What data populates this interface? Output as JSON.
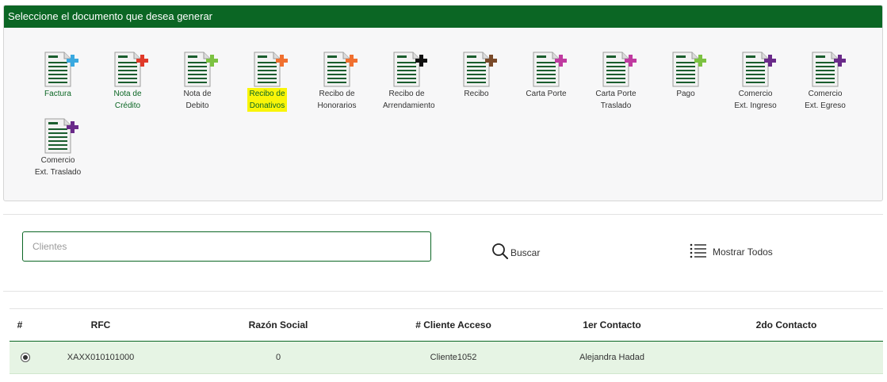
{
  "panel": {
    "title": "Seleccione el documento que desea generar",
    "header_color": "#0b6624",
    "documents": [
      {
        "label": "Factura",
        "icon": "document-plus-icon",
        "plus_color": "#3aa9e0",
        "label_style": "green"
      },
      {
        "label": "Nota de Crédito",
        "icon": "document-plus-icon",
        "plus_color": "#e03a2a",
        "label_style": "green"
      },
      {
        "label": "Nota de Debito",
        "icon": "document-plus-icon",
        "plus_color": "#7cc242",
        "label_style": "normal"
      },
      {
        "label": "Recibo de Donativos",
        "icon": "document-plus-icon",
        "plus_color": "#f07030",
        "label_style": "highlight"
      },
      {
        "label": "Recibo de Honorarios",
        "icon": "document-plus-icon",
        "plus_color": "#f07030",
        "label_style": "normal"
      },
      {
        "label": "Recibo de Arrendamiento",
        "icon": "document-plus-icon",
        "plus_color": "#111111",
        "label_style": "normal"
      },
      {
        "label": "Recibo",
        "icon": "document-plus-icon",
        "plus_color": "#7a4a2a",
        "label_style": "normal"
      },
      {
        "label": "Carta Porte",
        "icon": "document-plus-icon",
        "plus_color": "#c03aa0",
        "label_style": "normal"
      },
      {
        "label": "Carta Porte Traslado",
        "icon": "document-plus-icon",
        "plus_color": "#c03aa0",
        "label_style": "normal"
      },
      {
        "label": "Pago",
        "icon": "document-plus-icon",
        "plus_color": "#7cc242",
        "label_style": "normal"
      },
      {
        "label": "Comercio Ext. Ingreso",
        "icon": "document-plus-icon",
        "plus_color": "#6a2a8a",
        "label_style": "normal"
      },
      {
        "label": "Comercio Ext. Egreso",
        "icon": "document-plus-icon",
        "plus_color": "#6a2a8a",
        "label_style": "normal"
      },
      {
        "label": "Comercio Ext. Traslado",
        "icon": "document-plus-icon",
        "plus_color": "#6a2a8a",
        "label_style": "normal"
      }
    ]
  },
  "search": {
    "placeholder": "Clientes",
    "value": "",
    "buscar_label": "Buscar",
    "buscar_icon": "search-icon",
    "mostrar_label": "Mostrar Todos",
    "mostrar_icon": "list-icon"
  },
  "table": {
    "headers": [
      "#",
      "RFC",
      "Razón Social",
      "# Cliente Acceso",
      "1er Contacto",
      "2do Contacto"
    ],
    "rows": [
      {
        "selected": true,
        "rfc": "XAXX010101000",
        "razon_social": "0",
        "cliente_acceso": "Cliente1052",
        "contacto1": "Alejandra Hadad",
        "contacto2": ""
      }
    ],
    "row_highlight_color": "#e6f4e4"
  }
}
